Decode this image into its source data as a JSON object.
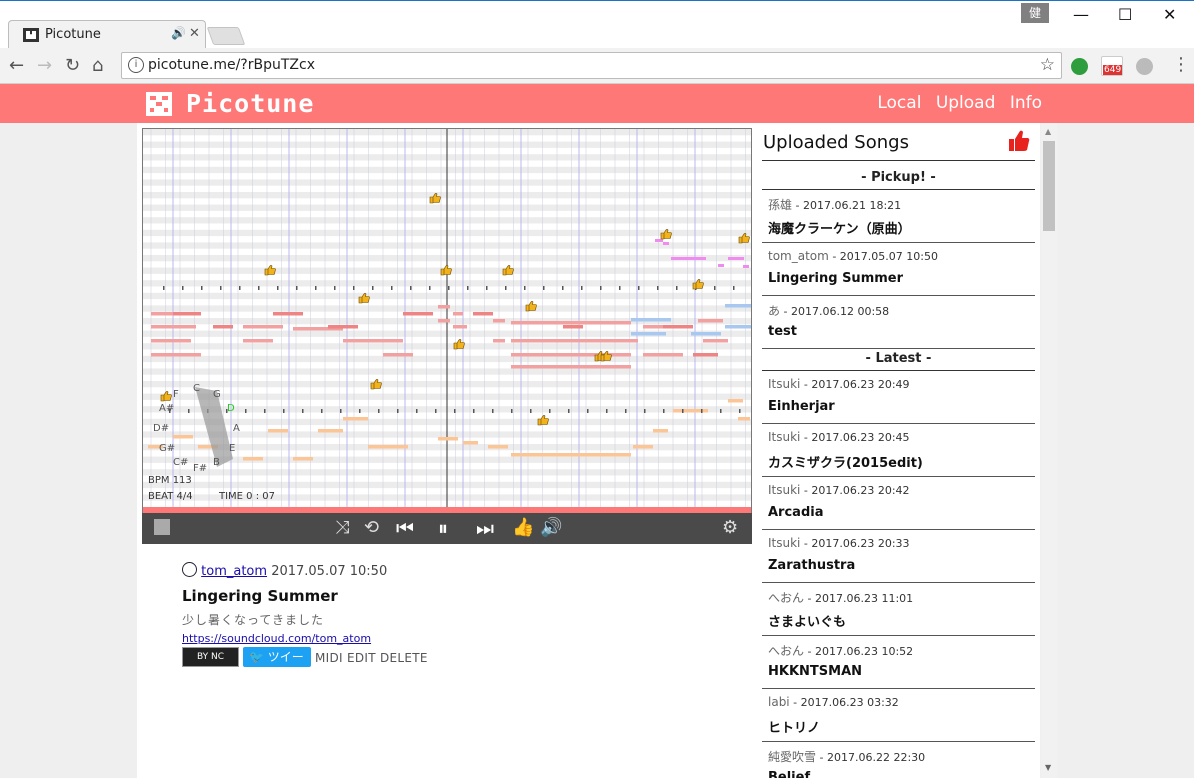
{
  "browser": {
    "tab_title": "Picotune",
    "tab_audio_icon": "speaker-icon",
    "user_chip": "健",
    "url": "picotune.me/?rBpuTZcx",
    "ext_badge": "649"
  },
  "site": {
    "logo": "Picotune",
    "nav": [
      "Local",
      "Upload",
      "Info"
    ]
  },
  "player": {
    "notes_left": [
      "F",
      "C",
      "G",
      "A#",
      "D",
      "D#",
      "A",
      "G#",
      "E",
      "C#",
      "F#",
      "B"
    ],
    "bpm": "BPM 113",
    "beat": "BEAT 4/4",
    "time": "TIME 0 : 07",
    "progress": 0.0
  },
  "song": {
    "author": "tom_atom",
    "date": "2017.05.07 10:50",
    "title": "Lingering Summer",
    "description": "少し暑くなってきました",
    "link": "https://soundcloud.com/tom_atom",
    "cc_label": "BY NC",
    "tweet_label": "ツイート",
    "actions": "MIDI EDIT DELETE"
  },
  "sidebar": {
    "title": "Uploaded Songs",
    "pickup_label": "- Pickup! -",
    "latest_label": "- Latest -",
    "pickup": [
      {
        "user": "孫雄",
        "date": "2017.06.21 18:21",
        "title": "海魔クラーケン（原曲）"
      },
      {
        "user": "tom_atom",
        "date": "2017.05.07 10:50",
        "title": "Lingering Summer"
      },
      {
        "user": "あ",
        "date": "2017.06.12 00:58",
        "title": "test"
      }
    ],
    "latest": [
      {
        "user": "Itsuki",
        "date": "2017.06.23 20:49",
        "title": "Einherjar"
      },
      {
        "user": "Itsuki",
        "date": "2017.06.23 20:45",
        "title": "カスミザクラ(2015edit)"
      },
      {
        "user": "Itsuki",
        "date": "2017.06.23 20:42",
        "title": "Arcadia"
      },
      {
        "user": "Itsuki",
        "date": "2017.06.23 20:33",
        "title": "Zarathustra"
      },
      {
        "user": "へおん",
        "date": "2017.06.23 11:01",
        "title": "さまよいぐも"
      },
      {
        "user": "へおん",
        "date": "2017.06.23 10:52",
        "title": "HKKNTSMAN"
      },
      {
        "user": "labi",
        "date": "2017.06.23 03:32",
        "title": "ヒトリノ"
      },
      {
        "user": "純愛吹雪",
        "date": "2017.06.22 22:30",
        "title": "Belief"
      }
    ]
  }
}
